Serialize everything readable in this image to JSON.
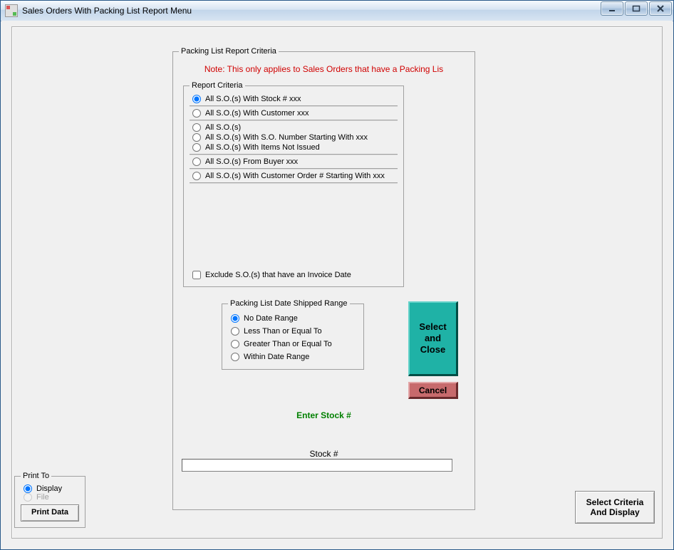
{
  "window": {
    "title": "Sales Orders With Packing List Report Menu"
  },
  "group": {
    "legend": "Packing List Report Criteria",
    "note": "Note: This only applies  to Sales Orders that have a Packing Lis"
  },
  "report_criteria": {
    "legend": "Report Criteria",
    "opt1": "All S.O.(s) With Stock # xxx",
    "opt2": "All S.O.(s) With Customer xxx",
    "opt3": "All S.O.(s)",
    "opt4": "All S.O.(s) With S.O. Number Starting With xxx",
    "opt5": "All S.O.(s) With Items Not Issued",
    "opt6": "All  S.O.(s) From Buyer xxx",
    "opt7": "All  S.O.(s) With Customer Order # Starting With xxx",
    "exclude": "Exclude S.O.(s) that have an Invoice Date"
  },
  "date_range": {
    "legend": "Packing List Date Shipped Range",
    "opt1": "No Date Range",
    "opt2": "Less Than or Equal To",
    "opt3": "Greater Than or Equal To",
    "opt4": "Within Date Range"
  },
  "buttons": {
    "select_close": "Select\nand\nClose",
    "cancel": "Cancel",
    "print_data": "Print Data",
    "select_criteria": "Select Criteria\nAnd Display"
  },
  "prompts": {
    "enter_stock": "Enter Stock #",
    "stock_label": "Stock #"
  },
  "print_to": {
    "legend": "Print To",
    "display": "Display",
    "file": "File"
  }
}
